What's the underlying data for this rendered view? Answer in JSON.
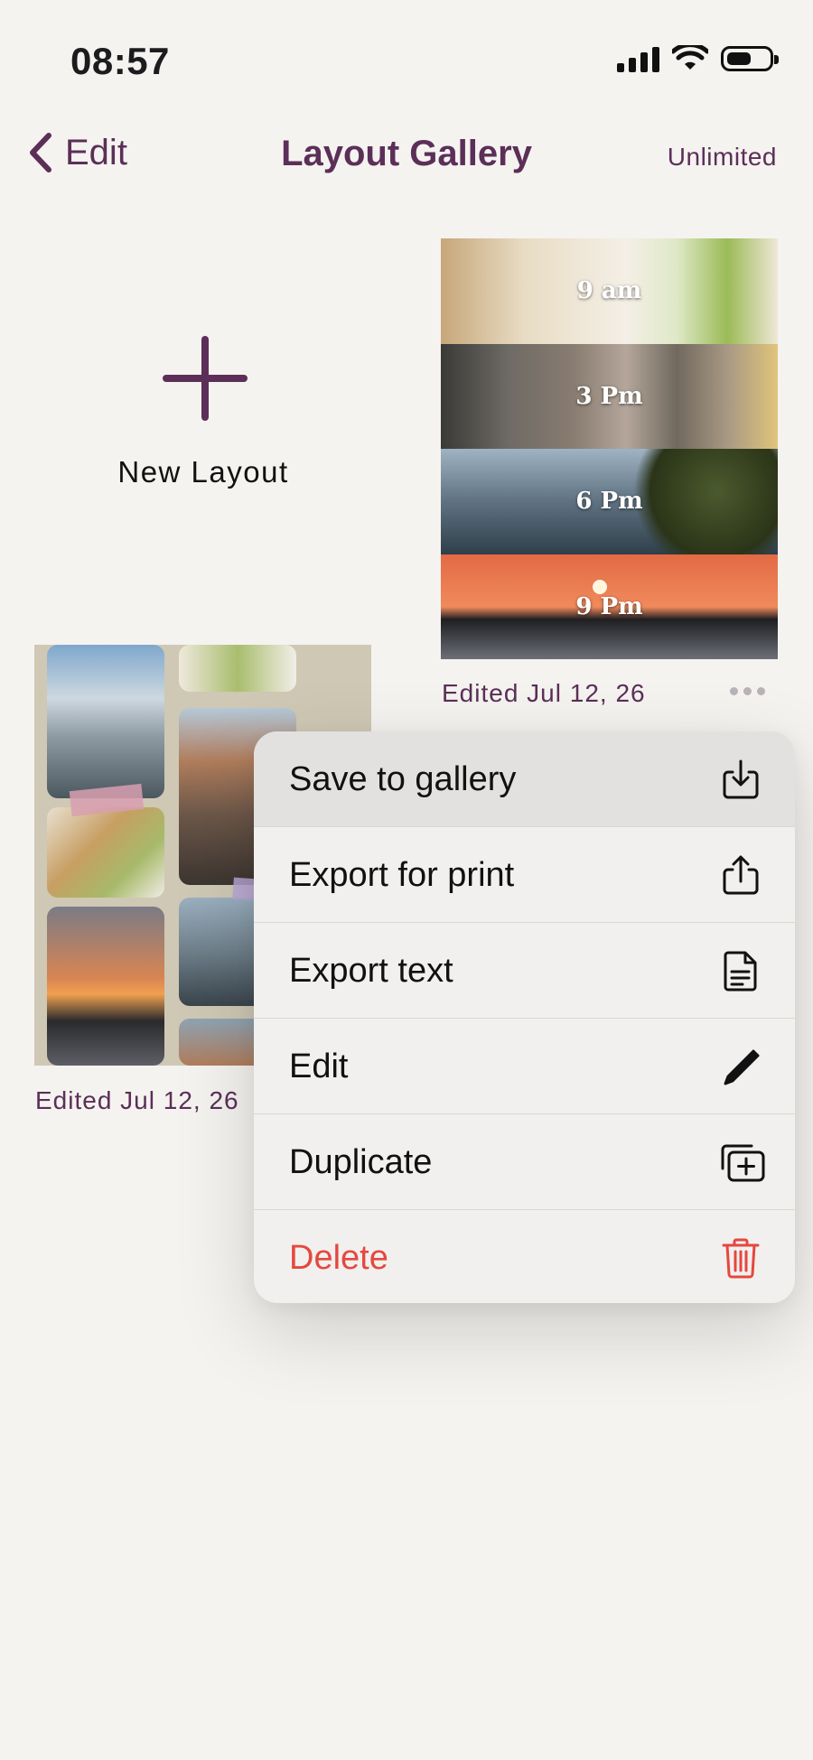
{
  "status": {
    "time": "08:57"
  },
  "nav": {
    "back_label": "Edit",
    "title": "Layout Gallery",
    "right_label": "Unlimited"
  },
  "gallery": {
    "new_layout_label": "New Layout",
    "layouts": [
      {
        "edited": "Edited Jul 12, 26",
        "captions": [
          "9 am",
          "3 Pm",
          "6 Pm",
          "9 Pm"
        ]
      },
      {
        "edited": "Edited Jul 12, 26"
      }
    ]
  },
  "menu": {
    "items": [
      {
        "label": "Save to gallery",
        "icon": "save-to-gallery-icon"
      },
      {
        "label": "Export for print",
        "icon": "share-icon"
      },
      {
        "label": "Export text",
        "icon": "document-icon"
      },
      {
        "label": "Edit",
        "icon": "pencil-icon"
      },
      {
        "label": "Duplicate",
        "icon": "duplicate-icon"
      },
      {
        "label": "Delete",
        "icon": "trash-icon"
      }
    ]
  },
  "colors": {
    "accent": "#5b2f58",
    "destructive": "#e5483e",
    "background": "#f5f3f0"
  }
}
